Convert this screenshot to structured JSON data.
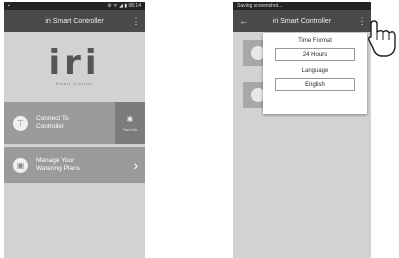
{
  "left_phone": {
    "status": {
      "left": "▪",
      "right": "⚙ ᯤ ◢ ▮ 08:14"
    },
    "toolbar": {
      "title": "iri Smart Controller",
      "menu": "⋮"
    },
    "logo": {
      "word": "iri",
      "sub": "Smart Control"
    },
    "connect": {
      "icon": "⊤",
      "text": "Connect To Controller",
      "bt_icon": "✱",
      "turn_on": "Turn On"
    },
    "manage": {
      "icon": "▣",
      "text": "Manage Your Watering Plans",
      "chevron": "›"
    }
  },
  "right_phone": {
    "status": {
      "left": "Saving screenshot...",
      "right": ""
    },
    "toolbar": {
      "back": "←",
      "title": "iri Smart Controller",
      "menu": "⋮"
    },
    "popup": {
      "time_format_label": "Time Format",
      "time_format_value": "24 Hours",
      "language_label": "Language",
      "language_value": "English"
    }
  },
  "hand_icon": "pointing-hand-icon"
}
